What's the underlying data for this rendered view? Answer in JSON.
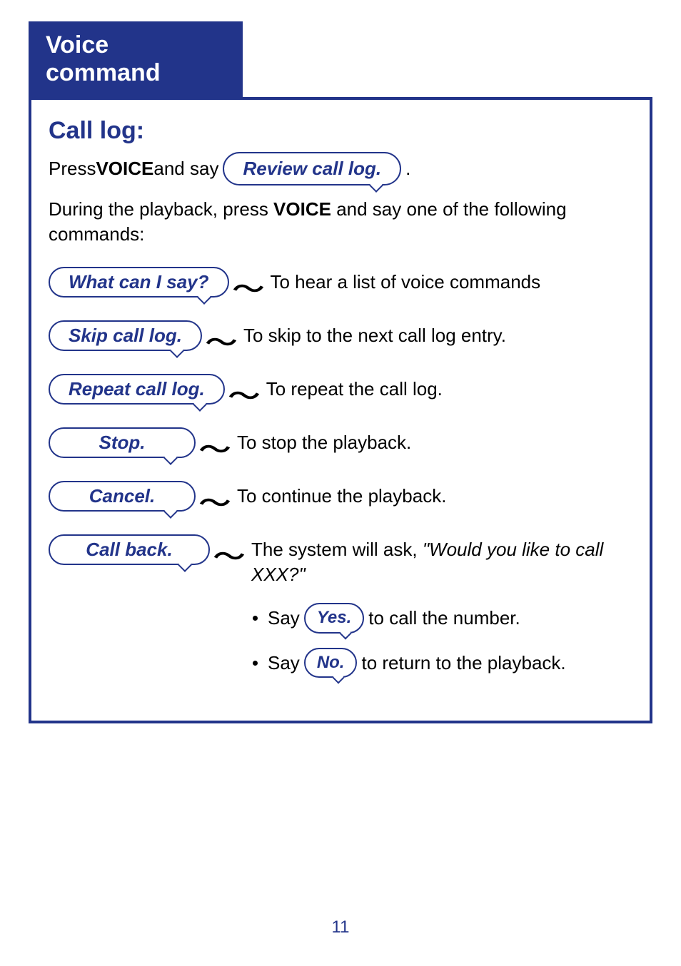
{
  "header": {
    "title": "Voice command"
  },
  "section": {
    "title": "Call log:",
    "press_prefix": "Press ",
    "voice_label": "VOICE",
    "and_say": " and say ",
    "period": ".",
    "initial_command": "Review call log.",
    "playback_intro_1": "During the playback, press ",
    "playback_intro_2": " and say one of the following commands:"
  },
  "commands": [
    {
      "phrase": "What can I say?",
      "desc": "To hear a list of voice commands"
    },
    {
      "phrase": "Skip call log.",
      "desc": "To skip to the next call log entry."
    },
    {
      "phrase": "Repeat call log.",
      "desc": "To repeat the call log."
    },
    {
      "phrase": "Stop.",
      "desc": "To stop the playback."
    },
    {
      "phrase": "Cancel.",
      "desc": "To continue the playback."
    }
  ],
  "callback": {
    "phrase": "Call back.",
    "ask_prefix": "The system will ask, ",
    "ask_quote": "\"Would you like to call XXX?\"",
    "say_label": "Say ",
    "yes_label": "Yes.",
    "yes_suffix": " to call the number.",
    "no_label": "No.",
    "no_suffix": " to return to the playback."
  },
  "page_number": "11"
}
